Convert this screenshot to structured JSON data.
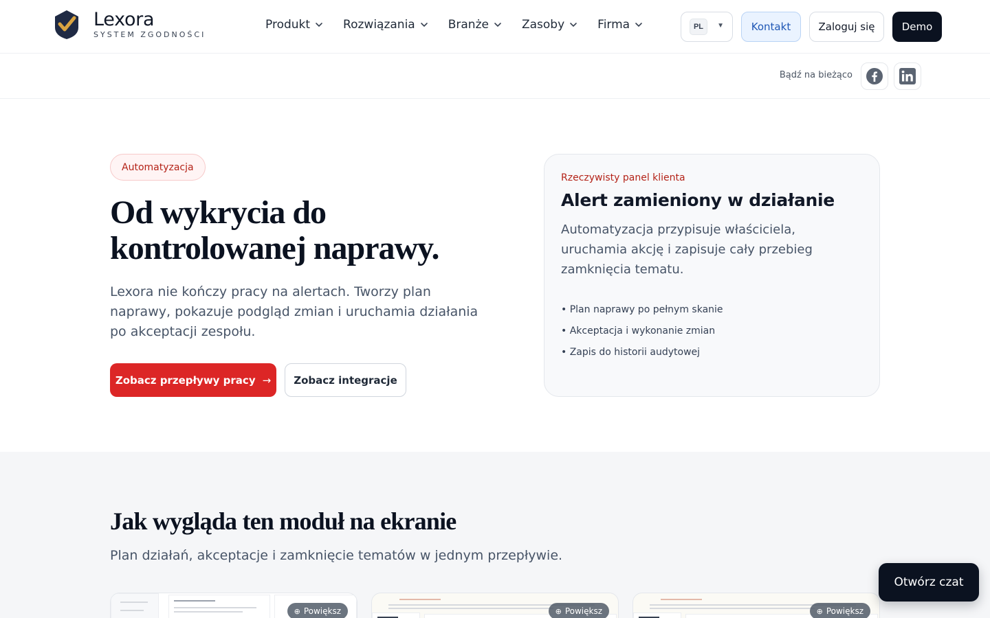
{
  "header": {
    "logo_name": "Lexora",
    "logo_tagline": "SYSTEM ZGODNOŚCI",
    "nav": [
      {
        "label": "Produkt"
      },
      {
        "label": "Rozwiązania"
      },
      {
        "label": "Branże"
      },
      {
        "label": "Zasoby"
      },
      {
        "label": "Firma"
      }
    ],
    "language": "PL",
    "contact_label": "Kontakt",
    "login_label": "Zaloguj się",
    "demo_label": "Demo"
  },
  "subbar": {
    "stay_updated": "Bądź na bieżąco",
    "social": [
      "facebook-icon",
      "linkedin-icon"
    ]
  },
  "hero": {
    "pill": "Automatyzacja",
    "title": "Od wykrycia do kontrolowanej naprawy.",
    "description": "Lexora nie kończy pracy na alertach. Tworzy plan naprawy, pokazuje podgląd zmian i uruchamia działania po akceptacji zespołu.",
    "primary_cta": "Zobacz przepływy pracy",
    "secondary_cta": "Zobacz integracje"
  },
  "panel": {
    "kicker": "Rzeczywisty panel klienta",
    "title": "Alert zamieniony w działanie",
    "description": "Automatyzacja przypisuje właściciela, uruchamia akcję i zapisuje cały przebieg zamknięcia tematu.",
    "items": [
      "• Plan naprawy po pełnym skanie",
      "• Akceptacja i wykonanie zmian",
      "• Zapis do historii audytowej"
    ]
  },
  "section2": {
    "title": "Jak wygląda ten moduł na ekranie",
    "subtitle": "Plan działań, akceptacje i zamknięcie tematów w jednym przepływie.",
    "zoom_label": "Powiększ"
  },
  "chat": {
    "label": "Otwórz czat"
  },
  "colors": {
    "accent_red": "#dc2626",
    "dark": "#0b1220",
    "contact_blue": "#1f57b5",
    "logo_gold": "#d9a441"
  }
}
